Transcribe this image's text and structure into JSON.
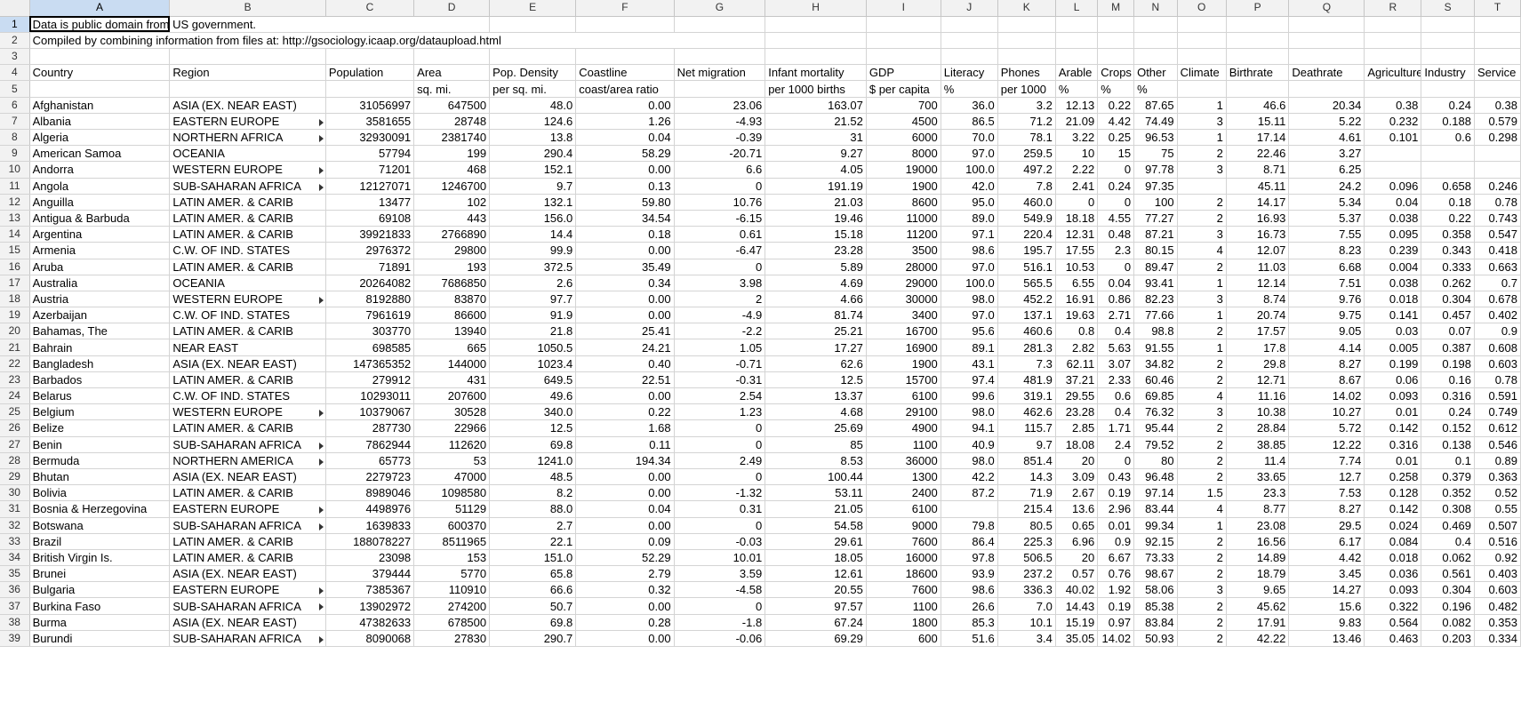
{
  "columns": [
    "A",
    "B",
    "C",
    "D",
    "E",
    "F",
    "G",
    "H",
    "I",
    "J",
    "K",
    "L",
    "M",
    "N",
    "O",
    "P",
    "Q",
    "R",
    "S",
    "T"
  ],
  "selected_column": "A",
  "selected_row": 1,
  "notes": [
    {
      "row": 1,
      "text": "Data is public domain from US government."
    },
    {
      "row": 2,
      "text": "Compiled by combining information from files at: http://gsociology.icaap.org/dataupload.html"
    }
  ],
  "header_row": {
    "row": 4,
    "cells": [
      "Country",
      "Region",
      "Population",
      "Area",
      "Pop. Density",
      "Coastline",
      "Net migration",
      "Infant mortality",
      "GDP",
      "Literacy",
      "Phones",
      "Arable",
      "Crops",
      "Other",
      "Climate",
      "Birthrate",
      "Deathrate",
      "Agriculture",
      "Industry",
      "Service"
    ]
  },
  "unit_row": {
    "row": 5,
    "cells": [
      "",
      "",
      "",
      "sq. mi.",
      "per sq. mi.",
      "coast/area ratio",
      "",
      "per 1000 births",
      "$ per capita",
      "%",
      "per 1000",
      "%",
      "%",
      "%",
      "",
      "",
      "",
      "",
      "",
      ""
    ]
  },
  "data_rows": [
    {
      "row": 6,
      "cells": [
        "Afghanistan",
        "ASIA (EX. NEAR EAST)",
        "31056997",
        "647500",
        "48.0",
        "0.00",
        "23.06",
        "163.07",
        "700",
        "36.0",
        "3.2",
        "12.13",
        "0.22",
        "87.65",
        "1",
        "46.6",
        "20.34",
        "0.38",
        "0.24",
        "0.38"
      ]
    },
    {
      "row": 7,
      "cells": [
        "Albania",
        "EASTERN EUROPE",
        "3581655",
        "28748",
        "124.6",
        "1.26",
        "-4.93",
        "21.52",
        "4500",
        "86.5",
        "71.2",
        "21.09",
        "4.42",
        "74.49",
        "3",
        "15.11",
        "5.22",
        "0.232",
        "0.188",
        "0.579"
      ]
    },
    {
      "row": 8,
      "cells": [
        "Algeria",
        "NORTHERN AFRICA",
        "32930091",
        "2381740",
        "13.8",
        "0.04",
        "-0.39",
        "31",
        "6000",
        "70.0",
        "78.1",
        "3.22",
        "0.25",
        "96.53",
        "1",
        "17.14",
        "4.61",
        "0.101",
        "0.6",
        "0.298"
      ]
    },
    {
      "row": 9,
      "cells": [
        "American Samoa",
        "OCEANIA",
        "57794",
        "199",
        "290.4",
        "58.29",
        "-20.71",
        "9.27",
        "8000",
        "97.0",
        "259.5",
        "10",
        "15",
        "75",
        "2",
        "22.46",
        "3.27",
        "",
        "",
        ""
      ]
    },
    {
      "row": 10,
      "cells": [
        "Andorra",
        "WESTERN EUROPE",
        "71201",
        "468",
        "152.1",
        "0.00",
        "6.6",
        "4.05",
        "19000",
        "100.0",
        "497.2",
        "2.22",
        "0",
        "97.78",
        "3",
        "8.71",
        "6.25",
        "",
        "",
        ""
      ]
    },
    {
      "row": 11,
      "cells": [
        "Angola",
        "SUB-SAHARAN AFRICA",
        "12127071",
        "1246700",
        "9.7",
        "0.13",
        "0",
        "191.19",
        "1900",
        "42.0",
        "7.8",
        "2.41",
        "0.24",
        "97.35",
        "",
        "45.11",
        "24.2",
        "0.096",
        "0.658",
        "0.246"
      ]
    },
    {
      "row": 12,
      "cells": [
        "Anguilla",
        "LATIN AMER. & CARIB",
        "13477",
        "102",
        "132.1",
        "59.80",
        "10.76",
        "21.03",
        "8600",
        "95.0",
        "460.0",
        "0",
        "0",
        "100",
        "2",
        "14.17",
        "5.34",
        "0.04",
        "0.18",
        "0.78"
      ]
    },
    {
      "row": 13,
      "cells": [
        "Antigua & Barbuda",
        "LATIN AMER. & CARIB",
        "69108",
        "443",
        "156.0",
        "34.54",
        "-6.15",
        "19.46",
        "11000",
        "89.0",
        "549.9",
        "18.18",
        "4.55",
        "77.27",
        "2",
        "16.93",
        "5.37",
        "0.038",
        "0.22",
        "0.743"
      ]
    },
    {
      "row": 14,
      "cells": [
        "Argentina",
        "LATIN AMER. & CARIB",
        "39921833",
        "2766890",
        "14.4",
        "0.18",
        "0.61",
        "15.18",
        "11200",
        "97.1",
        "220.4",
        "12.31",
        "0.48",
        "87.21",
        "3",
        "16.73",
        "7.55",
        "0.095",
        "0.358",
        "0.547"
      ]
    },
    {
      "row": 15,
      "cells": [
        "Armenia",
        "C.W. OF IND. STATES",
        "2976372",
        "29800",
        "99.9",
        "0.00",
        "-6.47",
        "23.28",
        "3500",
        "98.6",
        "195.7",
        "17.55",
        "2.3",
        "80.15",
        "4",
        "12.07",
        "8.23",
        "0.239",
        "0.343",
        "0.418"
      ]
    },
    {
      "row": 16,
      "cells": [
        "Aruba",
        "LATIN AMER. & CARIB",
        "71891",
        "193",
        "372.5",
        "35.49",
        "0",
        "5.89",
        "28000",
        "97.0",
        "516.1",
        "10.53",
        "0",
        "89.47",
        "2",
        "11.03",
        "6.68",
        "0.004",
        "0.333",
        "0.663"
      ]
    },
    {
      "row": 17,
      "cells": [
        "Australia",
        "OCEANIA",
        "20264082",
        "7686850",
        "2.6",
        "0.34",
        "3.98",
        "4.69",
        "29000",
        "100.0",
        "565.5",
        "6.55",
        "0.04",
        "93.41",
        "1",
        "12.14",
        "7.51",
        "0.038",
        "0.262",
        "0.7"
      ]
    },
    {
      "row": 18,
      "cells": [
        "Austria",
        "WESTERN EUROPE",
        "8192880",
        "83870",
        "97.7",
        "0.00",
        "2",
        "4.66",
        "30000",
        "98.0",
        "452.2",
        "16.91",
        "0.86",
        "82.23",
        "3",
        "8.74",
        "9.76",
        "0.018",
        "0.304",
        "0.678"
      ]
    },
    {
      "row": 19,
      "cells": [
        "Azerbaijan",
        "C.W. OF IND. STATES",
        "7961619",
        "86600",
        "91.9",
        "0.00",
        "-4.9",
        "81.74",
        "3400",
        "97.0",
        "137.1",
        "19.63",
        "2.71",
        "77.66",
        "1",
        "20.74",
        "9.75",
        "0.141",
        "0.457",
        "0.402"
      ]
    },
    {
      "row": 20,
      "cells": [
        "Bahamas, The",
        "LATIN AMER. & CARIB",
        "303770",
        "13940",
        "21.8",
        "25.41",
        "-2.2",
        "25.21",
        "16700",
        "95.6",
        "460.6",
        "0.8",
        "0.4",
        "98.8",
        "2",
        "17.57",
        "9.05",
        "0.03",
        "0.07",
        "0.9"
      ]
    },
    {
      "row": 21,
      "cells": [
        "Bahrain",
        "NEAR EAST",
        "698585",
        "665",
        "1050.5",
        "24.21",
        "1.05",
        "17.27",
        "16900",
        "89.1",
        "281.3",
        "2.82",
        "5.63",
        "91.55",
        "1",
        "17.8",
        "4.14",
        "0.005",
        "0.387",
        "0.608"
      ]
    },
    {
      "row": 22,
      "cells": [
        "Bangladesh",
        "ASIA (EX. NEAR EAST)",
        "147365352",
        "144000",
        "1023.4",
        "0.40",
        "-0.71",
        "62.6",
        "1900",
        "43.1",
        "7.3",
        "62.11",
        "3.07",
        "34.82",
        "2",
        "29.8",
        "8.27",
        "0.199",
        "0.198",
        "0.603"
      ]
    },
    {
      "row": 23,
      "cells": [
        "Barbados",
        "LATIN AMER. & CARIB",
        "279912",
        "431",
        "649.5",
        "22.51",
        "-0.31",
        "12.5",
        "15700",
        "97.4",
        "481.9",
        "37.21",
        "2.33",
        "60.46",
        "2",
        "12.71",
        "8.67",
        "0.06",
        "0.16",
        "0.78"
      ]
    },
    {
      "row": 24,
      "cells": [
        "Belarus",
        "C.W. OF IND. STATES",
        "10293011",
        "207600",
        "49.6",
        "0.00",
        "2.54",
        "13.37",
        "6100",
        "99.6",
        "319.1",
        "29.55",
        "0.6",
        "69.85",
        "4",
        "11.16",
        "14.02",
        "0.093",
        "0.316",
        "0.591"
      ]
    },
    {
      "row": 25,
      "cells": [
        "Belgium",
        "WESTERN EUROPE",
        "10379067",
        "30528",
        "340.0",
        "0.22",
        "1.23",
        "4.68",
        "29100",
        "98.0",
        "462.6",
        "23.28",
        "0.4",
        "76.32",
        "3",
        "10.38",
        "10.27",
        "0.01",
        "0.24",
        "0.749"
      ]
    },
    {
      "row": 26,
      "cells": [
        "Belize",
        "LATIN AMER. & CARIB",
        "287730",
        "22966",
        "12.5",
        "1.68",
        "0",
        "25.69",
        "4900",
        "94.1",
        "115.7",
        "2.85",
        "1.71",
        "95.44",
        "2",
        "28.84",
        "5.72",
        "0.142",
        "0.152",
        "0.612"
      ]
    },
    {
      "row": 27,
      "cells": [
        "Benin",
        "SUB-SAHARAN AFRICA",
        "7862944",
        "112620",
        "69.8",
        "0.11",
        "0",
        "85",
        "1100",
        "40.9",
        "9.7",
        "18.08",
        "2.4",
        "79.52",
        "2",
        "38.85",
        "12.22",
        "0.316",
        "0.138",
        "0.546"
      ]
    },
    {
      "row": 28,
      "cells": [
        "Bermuda",
        "NORTHERN AMERICA",
        "65773",
        "53",
        "1241.0",
        "194.34",
        "2.49",
        "8.53",
        "36000",
        "98.0",
        "851.4",
        "20",
        "0",
        "80",
        "2",
        "11.4",
        "7.74",
        "0.01",
        "0.1",
        "0.89"
      ]
    },
    {
      "row": 29,
      "cells": [
        "Bhutan",
        "ASIA (EX. NEAR EAST)",
        "2279723",
        "47000",
        "48.5",
        "0.00",
        "0",
        "100.44",
        "1300",
        "42.2",
        "14.3",
        "3.09",
        "0.43",
        "96.48",
        "2",
        "33.65",
        "12.7",
        "0.258",
        "0.379",
        "0.363"
      ]
    },
    {
      "row": 30,
      "cells": [
        "Bolivia",
        "LATIN AMER. & CARIB",
        "8989046",
        "1098580",
        "8.2",
        "0.00",
        "-1.32",
        "53.11",
        "2400",
        "87.2",
        "71.9",
        "2.67",
        "0.19",
        "97.14",
        "1.5",
        "23.3",
        "7.53",
        "0.128",
        "0.352",
        "0.52"
      ]
    },
    {
      "row": 31,
      "cells": [
        "Bosnia & Herzegovina",
        "EASTERN EUROPE",
        "4498976",
        "51129",
        "88.0",
        "0.04",
        "0.31",
        "21.05",
        "6100",
        "",
        "215.4",
        "13.6",
        "2.96",
        "83.44",
        "4",
        "8.77",
        "8.27",
        "0.142",
        "0.308",
        "0.55"
      ]
    },
    {
      "row": 32,
      "cells": [
        "Botswana",
        "SUB-SAHARAN AFRICA",
        "1639833",
        "600370",
        "2.7",
        "0.00",
        "0",
        "54.58",
        "9000",
        "79.8",
        "80.5",
        "0.65",
        "0.01",
        "99.34",
        "1",
        "23.08",
        "29.5",
        "0.024",
        "0.469",
        "0.507"
      ]
    },
    {
      "row": 33,
      "cells": [
        "Brazil",
        "LATIN AMER. & CARIB",
        "188078227",
        "8511965",
        "22.1",
        "0.09",
        "-0.03",
        "29.61",
        "7600",
        "86.4",
        "225.3",
        "6.96",
        "0.9",
        "92.15",
        "2",
        "16.56",
        "6.17",
        "0.084",
        "0.4",
        "0.516"
      ]
    },
    {
      "row": 34,
      "cells": [
        "British Virgin Is.",
        "LATIN AMER. & CARIB",
        "23098",
        "153",
        "151.0",
        "52.29",
        "10.01",
        "18.05",
        "16000",
        "97.8",
        "506.5",
        "20",
        "6.67",
        "73.33",
        "2",
        "14.89",
        "4.42",
        "0.018",
        "0.062",
        "0.92"
      ]
    },
    {
      "row": 35,
      "cells": [
        "Brunei",
        "ASIA (EX. NEAR EAST)",
        "379444",
        "5770",
        "65.8",
        "2.79",
        "3.59",
        "12.61",
        "18600",
        "93.9",
        "237.2",
        "0.57",
        "0.76",
        "98.67",
        "2",
        "18.79",
        "3.45",
        "0.036",
        "0.561",
        "0.403"
      ]
    },
    {
      "row": 36,
      "cells": [
        "Bulgaria",
        "EASTERN EUROPE",
        "7385367",
        "110910",
        "66.6",
        "0.32",
        "-4.58",
        "20.55",
        "7600",
        "98.6",
        "336.3",
        "40.02",
        "1.92",
        "58.06",
        "3",
        "9.65",
        "14.27",
        "0.093",
        "0.304",
        "0.603"
      ]
    },
    {
      "row": 37,
      "cells": [
        "Burkina Faso",
        "SUB-SAHARAN AFRICA",
        "13902972",
        "274200",
        "50.7",
        "0.00",
        "0",
        "97.57",
        "1100",
        "26.6",
        "7.0",
        "14.43",
        "0.19",
        "85.38",
        "2",
        "45.62",
        "15.6",
        "0.322",
        "0.196",
        "0.482"
      ]
    },
    {
      "row": 38,
      "cells": [
        "Burma",
        "ASIA (EX. NEAR EAST)",
        "47382633",
        "678500",
        "69.8",
        "0.28",
        "-1.8",
        "67.24",
        "1800",
        "85.3",
        "10.1",
        "15.19",
        "0.97",
        "83.84",
        "2",
        "17.91",
        "9.83",
        "0.564",
        "0.082",
        "0.353"
      ]
    },
    {
      "row": 39,
      "cells": [
        "Burundi",
        "SUB-SAHARAN AFRICA",
        "8090068",
        "27830",
        "290.7",
        "0.00",
        "-0.06",
        "69.29",
        "600",
        "51.6",
        "3.4",
        "35.05",
        "14.02",
        "50.93",
        "2",
        "42.22",
        "13.46",
        "0.463",
        "0.203",
        "0.334"
      ]
    }
  ]
}
